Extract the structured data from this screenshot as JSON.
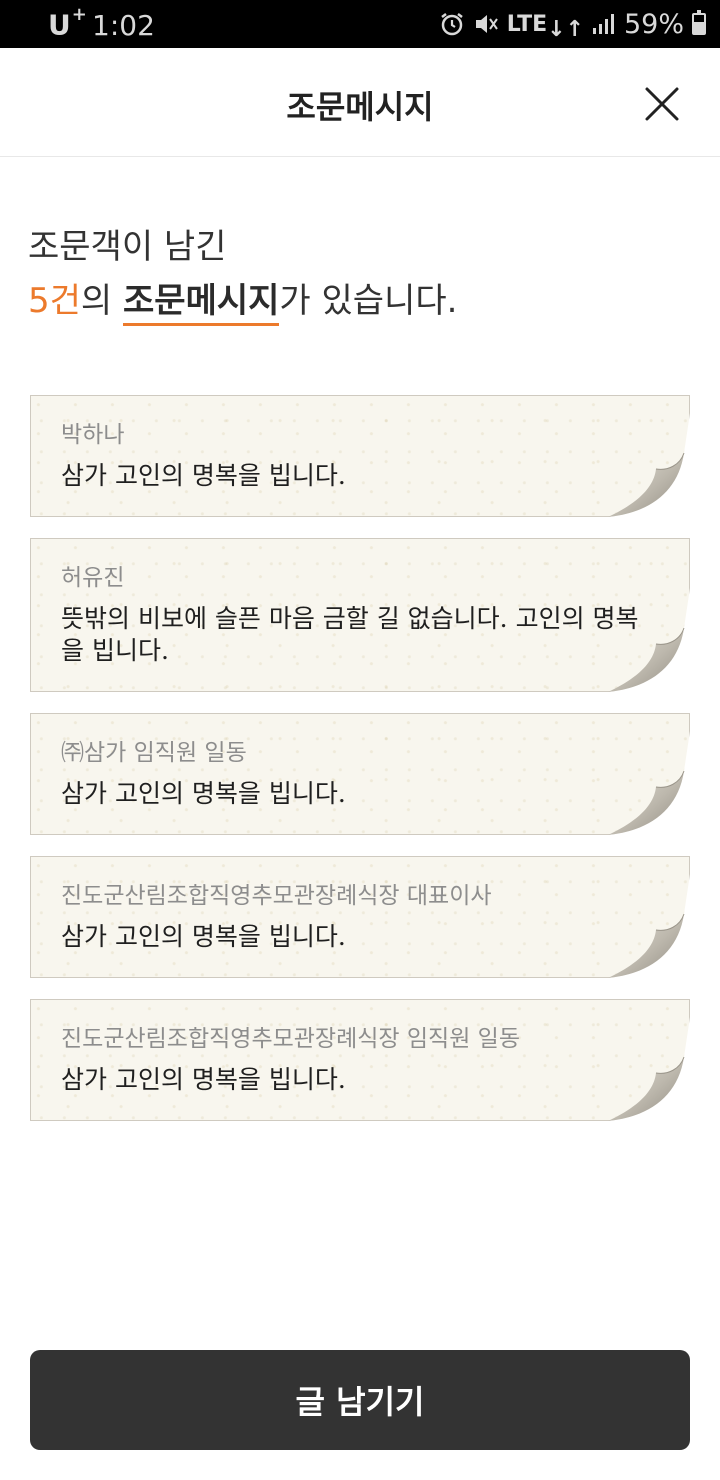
{
  "status_bar": {
    "carrier": "U",
    "carrier_sup": "+",
    "time": "1:02",
    "network": "LTE",
    "battery_percent": "59%",
    "battery_level": 0.59,
    "icons": [
      "alarm-icon",
      "mute-icon",
      "lte-icon",
      "signal-icon",
      "battery-icon"
    ]
  },
  "header": {
    "title": "조문메시지",
    "close_icon": "close-icon"
  },
  "intro": {
    "line1": "조문객이 남긴",
    "count": "5건",
    "mid": "의 ",
    "highlight": "조문메시지",
    "suffix": "가 있습니다."
  },
  "messages": [
    {
      "author": "박하나",
      "text": "삼가 고인의 명복을 빕니다."
    },
    {
      "author": "허유진",
      "text": "뜻밖의 비보에 슬픈 마음 금할 길 없습니다. 고인의 명복을 빕니다."
    },
    {
      "author": "㈜삼가 임직원 일동",
      "text": "삼가 고인의 명복을 빕니다."
    },
    {
      "author": "진도군산림조합직영추모관장례식장 대표이사",
      "text": "삼가 고인의 명복을 빕니다."
    },
    {
      "author": "진도군산림조합직영추모관장례식장 임직원 일동",
      "text": "삼가 고인의 명복을 빕니다."
    }
  ],
  "footer": {
    "write_button": "글 남기기"
  },
  "colors": {
    "accent": "#ec7a2c",
    "button_bg": "#333333",
    "card_bg": "#f8f6ee"
  }
}
